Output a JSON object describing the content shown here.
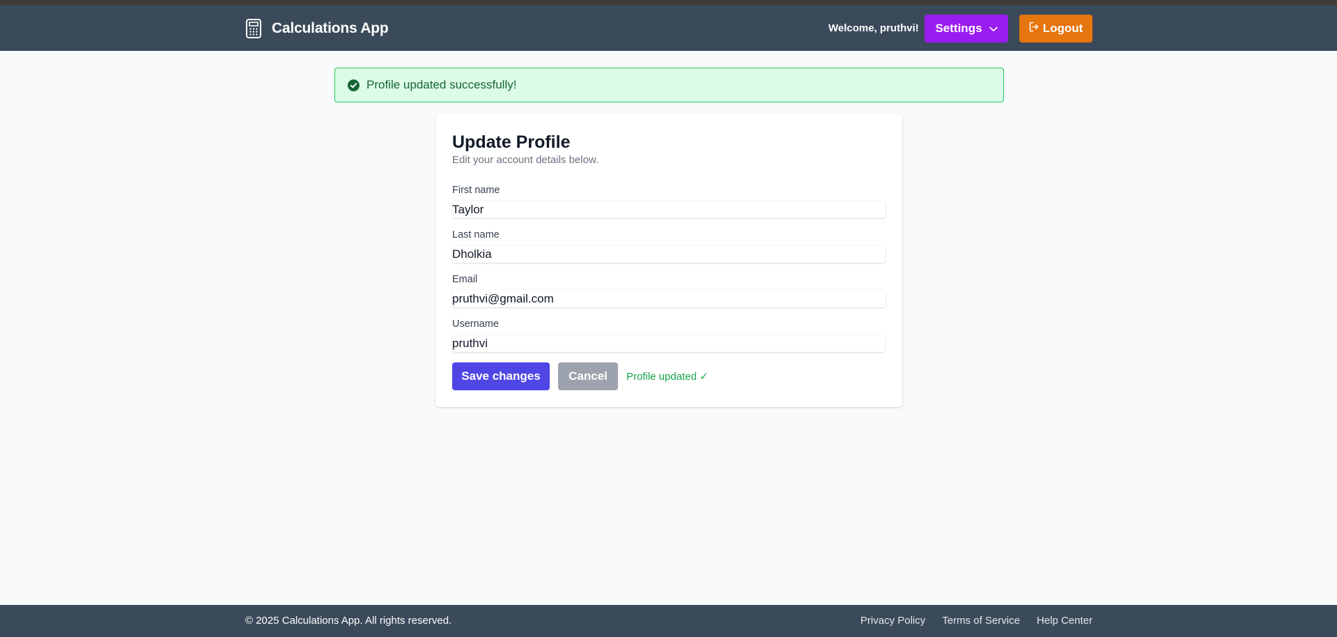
{
  "app": {
    "name": "Calculations App"
  },
  "header": {
    "welcome": "Welcome, pruthvi!",
    "settings_label": "Settings",
    "logout_label": "Logout"
  },
  "alert": {
    "message": "Profile updated successfully!"
  },
  "form": {
    "title": "Update Profile",
    "subtitle": "Edit your account details below.",
    "fields": [
      {
        "label": "First name",
        "value": "Taylor"
      },
      {
        "label": "Last name",
        "value": "Dholkia"
      },
      {
        "label": "Email",
        "value": "pruthvi@gmail.com"
      },
      {
        "label": "Username",
        "value": "pruthvi"
      }
    ],
    "save_label": "Save changes",
    "cancel_label": "Cancel",
    "status": "Profile updated ✓"
  },
  "footer": {
    "copyright": "© 2025 Calculations App. All rights reserved.",
    "links": [
      "Privacy Policy",
      "Terms of Service",
      "Help Center"
    ]
  },
  "colors": {
    "navbar": "#3b4a5a",
    "settings": "#9b1cf0",
    "logout": "#e5750e",
    "primary": "#4f46e5",
    "success": "#16a34a"
  },
  "icons": {
    "brand": "calculator-icon",
    "settings_caret": "chevron-down-icon",
    "logout": "logout-icon",
    "alert": "check-circle-icon"
  }
}
